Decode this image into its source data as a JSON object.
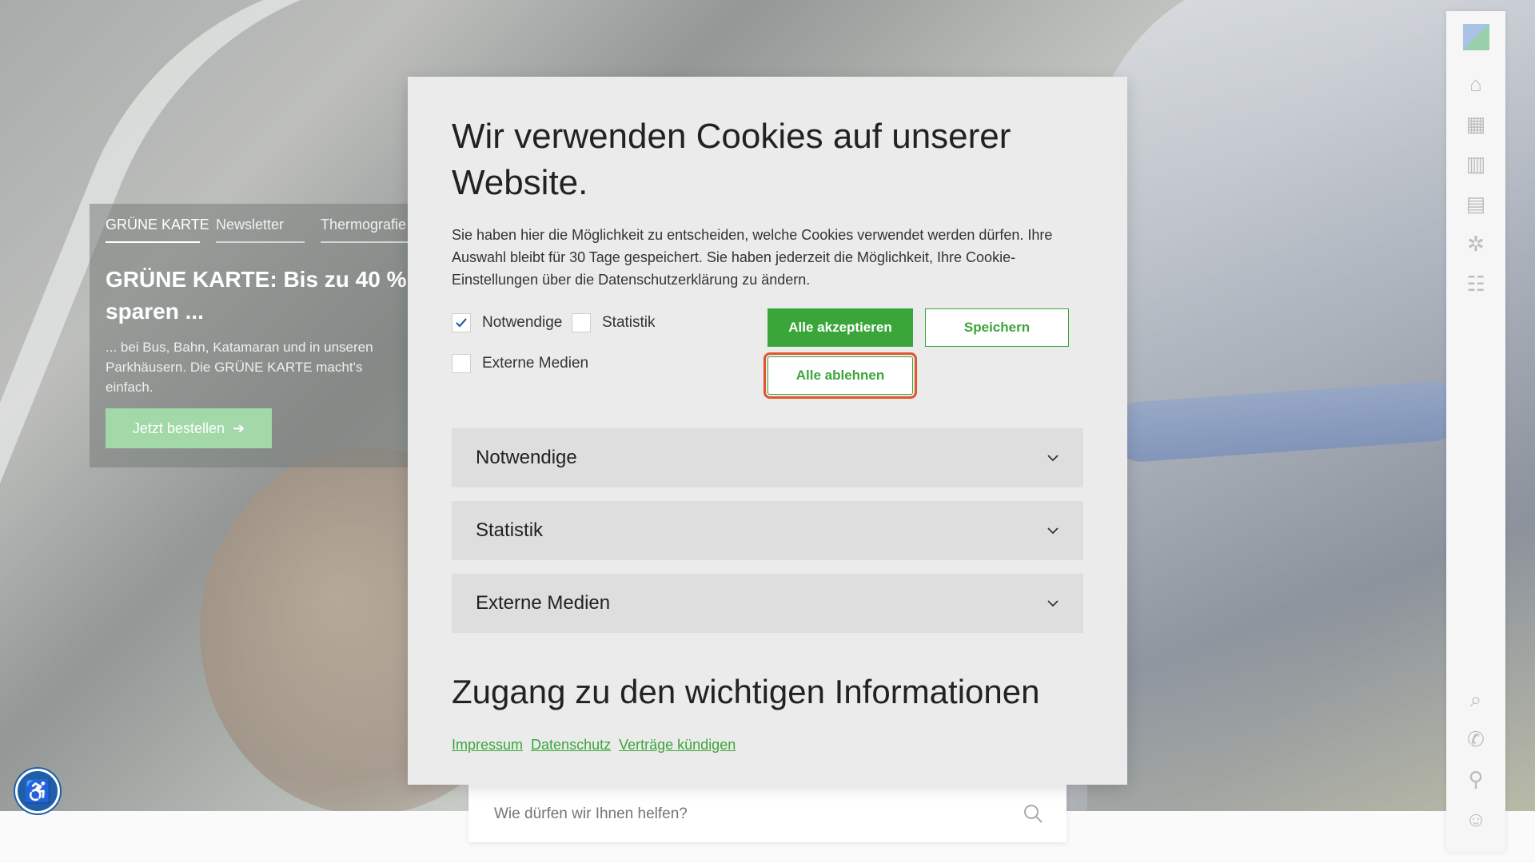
{
  "promo": {
    "tabs": [
      "GRÜNE KARTE",
      "Newsletter",
      "Thermografie"
    ],
    "headline": "GRÜNE KARTE: Bis zu 40 % sparen ...",
    "text": "... bei Bus, Bahn, Katamaran und in unseren Parkhäusern. Die GRÜNE KARTE macht's einfach.",
    "cta_label": "Jetzt bestellen"
  },
  "dock": {
    "icons": [
      "home-icon",
      "brick-wall-icon",
      "buildings-icon",
      "bus-icon",
      "network-icon",
      "people-icon",
      "search-icon",
      "phone-icon",
      "location-pin-icon",
      "group-icon"
    ]
  },
  "search": {
    "placeholder": "Wie dürfen wir Ihnen helfen?"
  },
  "cookie_dialog": {
    "title": "Wir verwenden Cookies auf unserer Website.",
    "description": "Sie haben hier die Möglichkeit zu entscheiden, welche Cookies verwendet werden dürfen. Ihre Auswahl bleibt für 30 Tage gespeichert. Sie haben jederzeit die Möglichkeit, Ihre Cookie-Einstellungen über die Datenschutzerklärung zu ändern.",
    "options": [
      {
        "label": "Notwendige",
        "checked": true
      },
      {
        "label": "Statistik",
        "checked": false
      },
      {
        "label": "Externe Medien",
        "checked": false
      }
    ],
    "buttons": {
      "accept_all": "Alle akzeptieren",
      "save": "Speichern",
      "reject_all": "Alle ablehnen"
    },
    "sections": [
      "Notwendige",
      "Statistik",
      "Externe Medien"
    ],
    "info_heading": "Zugang zu den wichtigen Informationen",
    "links": [
      "Impressum",
      "Datenschutz",
      "Verträge kündigen"
    ]
  },
  "colors": {
    "accent_green": "#3aa63a",
    "focus_ring": "#e1552f",
    "a11y_blue": "#1f5fa8"
  }
}
